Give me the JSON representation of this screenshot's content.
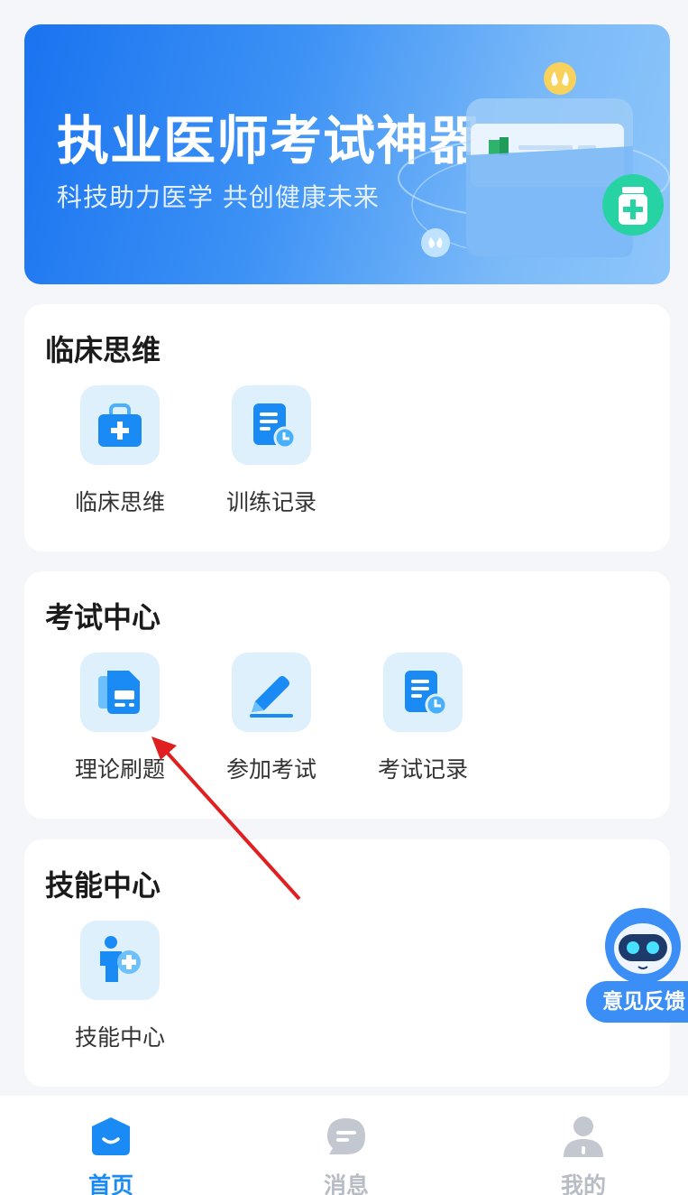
{
  "banner": {
    "title": "执业医师考试神器",
    "subtitle": "科技助力医学  共创健康未来"
  },
  "sections": {
    "clinical": {
      "title": "临床思维",
      "items": [
        {
          "label": "临床思维",
          "icon": "medical-kit-icon"
        },
        {
          "label": "训练记录",
          "icon": "document-clock-icon"
        }
      ]
    },
    "exam": {
      "title": "考试中心",
      "items": [
        {
          "label": "理论刷题",
          "icon": "document-stack-icon"
        },
        {
          "label": "参加考试",
          "icon": "pencil-icon"
        },
        {
          "label": "考试记录",
          "icon": "document-clock-icon"
        }
      ]
    },
    "skill": {
      "title": "技能中心",
      "items": [
        {
          "label": "技能中心",
          "icon": "person-plus-icon"
        }
      ]
    }
  },
  "feedback": {
    "label": "意见反馈",
    "icon": "robot-icon"
  },
  "tabbar": {
    "items": [
      {
        "label": "首页",
        "icon": "home-icon",
        "active": true
      },
      {
        "label": "消息",
        "icon": "message-icon",
        "active": false
      },
      {
        "label": "我的",
        "icon": "profile-icon",
        "active": false
      }
    ]
  },
  "colors": {
    "accent": "#1a8af5",
    "icon_bg": "#dff0fd",
    "annotation": "#e02020",
    "inactive_tab": "#b8bcc4"
  }
}
